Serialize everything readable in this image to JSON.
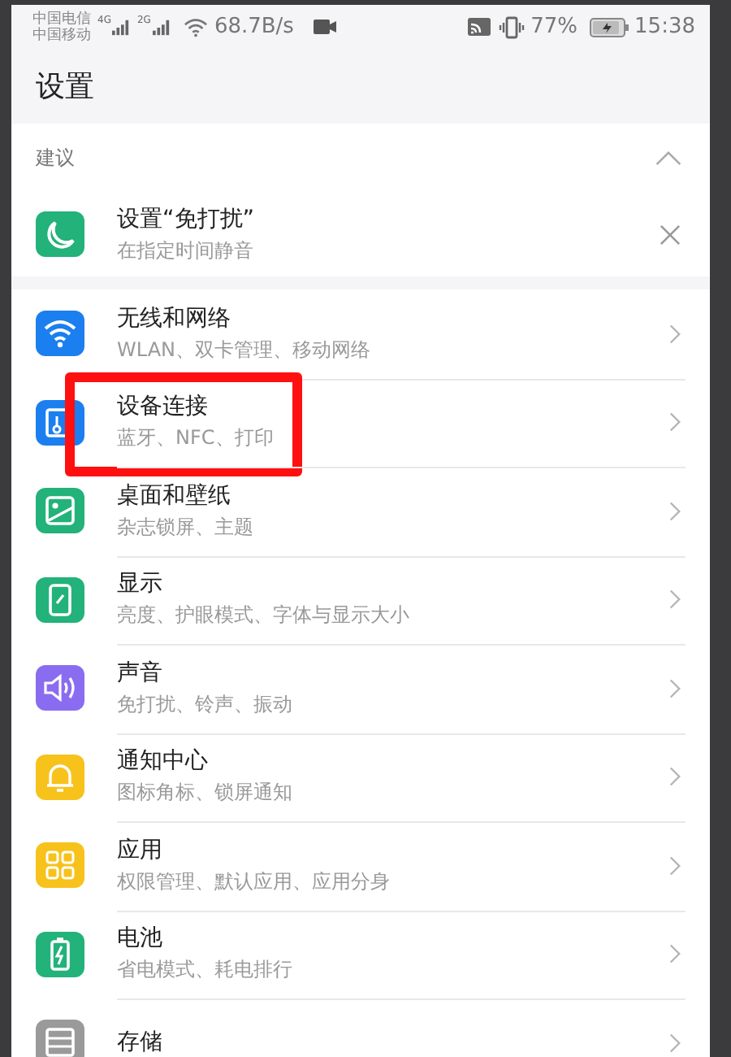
{
  "status_bar": {
    "carrier_1": "中国电信",
    "carrier_2": "中国移动",
    "network_1": "4G",
    "network_2": "2G",
    "speed": "68.7B/s",
    "battery": "77%",
    "time": "15:38"
  },
  "title": "设置",
  "suggestions": {
    "header": "建议",
    "expanded": true,
    "item": {
      "title": "设置“免打扰”",
      "subtitle": "在指定时间静音",
      "color": "#22b27a"
    }
  },
  "items": [
    {
      "title": "无线和网络",
      "subtitle": "WLAN、双卡管理、移动网络",
      "color": "#1b7ff0",
      "highlighted": false
    },
    {
      "title": "设备连接",
      "subtitle": "蓝牙、NFC、打印",
      "color": "#1b7ff0",
      "highlighted": true
    },
    {
      "title": "桌面和壁纸",
      "subtitle": "杂志锁屏、主题",
      "color": "#22b27a",
      "highlighted": false
    },
    {
      "title": "显示",
      "subtitle": "亮度、护眼模式、字体与显示大小",
      "color": "#22b27a",
      "highlighted": false
    },
    {
      "title": "声音",
      "subtitle": "免打扰、铃声、振动",
      "color": "#8a6cf0",
      "highlighted": false
    },
    {
      "title": "通知中心",
      "subtitle": "图标角标、锁屏通知",
      "color": "#f7c21c",
      "highlighted": false
    },
    {
      "title": "应用",
      "subtitle": "权限管理、默认应用、应用分身",
      "color": "#f7c21c",
      "highlighted": false
    },
    {
      "title": "电池",
      "subtitle": "省电模式、耗电排行",
      "color": "#22b27a",
      "highlighted": false
    },
    {
      "title": "存储",
      "color": "#9a9a9a",
      "highlighted": false
    }
  ]
}
